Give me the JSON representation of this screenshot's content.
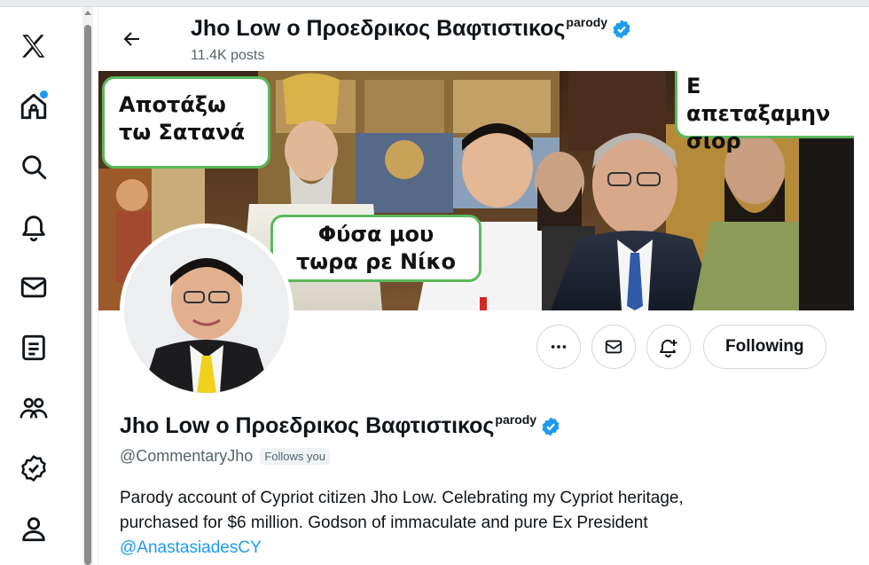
{
  "nav": {
    "items": [
      {
        "icon": "x-logo-icon"
      },
      {
        "icon": "home-icon",
        "has_notification_dot": true
      },
      {
        "icon": "search-icon"
      },
      {
        "icon": "bell-icon"
      },
      {
        "icon": "mail-icon"
      },
      {
        "icon": "list-icon"
      },
      {
        "icon": "communities-icon"
      },
      {
        "icon": "verified-icon"
      },
      {
        "icon": "profile-icon"
      }
    ]
  },
  "header": {
    "title": "Jho Low ο Προεδρικος Βαφτιστικος",
    "title_sup": "parody",
    "posts": "11.4K posts"
  },
  "banner": {
    "bubble_1": [
      "Αποτάξω",
      "τω Σατανά"
    ],
    "bubble_2": [
      "Φύσα μου",
      "τωρα ρε Νίκο"
    ],
    "bubble_3": [
      "Ε απεταξαμην",
      "σιορ"
    ]
  },
  "actions": {
    "more_icon": "more-icon",
    "message_icon": "mail-icon",
    "notify_icon": "bell-plus-icon",
    "follow_label": "Following"
  },
  "profile": {
    "name": "Jho Low ο Προεδρικος Βαφτιστικος",
    "name_sup": "parody",
    "handle": "@CommentaryJho",
    "follows_you": "Follows you",
    "bio_line1": "Parody account of Cypriot citizen Jho Low. Celebrating my Cypriot heritage,",
    "bio_line2": "purchased for $6 million. Godson of immaculate and pure Ex President",
    "bio_mention": "@AnastasiadesCY"
  },
  "colors": {
    "accent": "#1d9bf0",
    "bubble_border": "#5cb85c",
    "text": "#0f1419",
    "muted": "#536471"
  }
}
